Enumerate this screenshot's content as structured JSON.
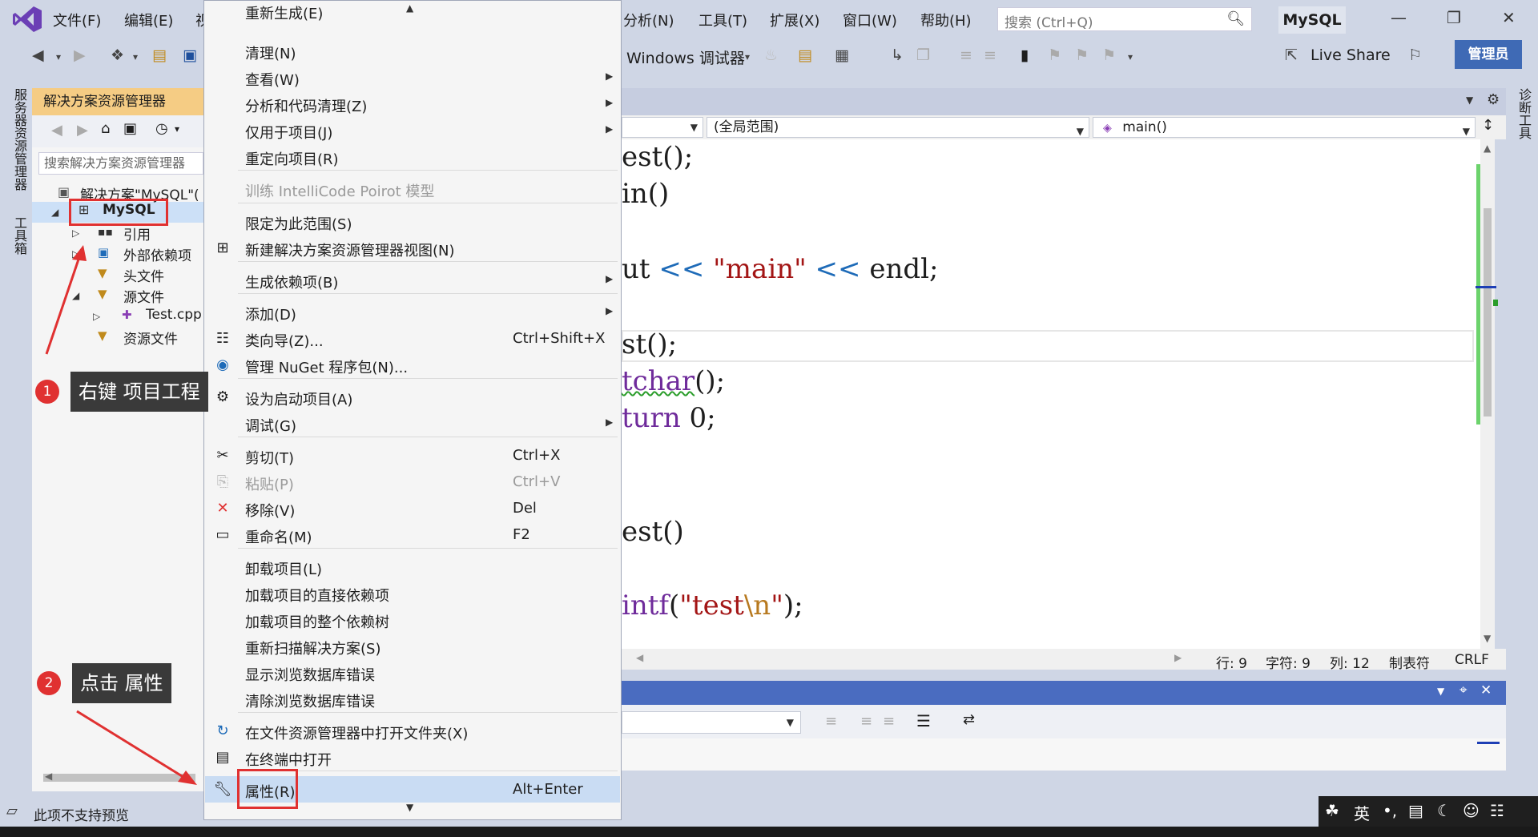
{
  "menubar": {
    "items": [
      "文件(F)",
      "编辑(E)",
      "视",
      "分析(N)",
      "工具(T)",
      "扩展(X)",
      "窗口(W)",
      "帮助(H)"
    ],
    "search_placeholder": "搜索 (Ctrl+Q)",
    "solution_name": "MySQL"
  },
  "toolbar": {
    "debugger_label": "Windows 调试器",
    "live_share": "Live Share",
    "admin": "管理员"
  },
  "left_rail": {
    "server_explorer": "服务器资源管理器",
    "toolbox": "工具箱"
  },
  "right_rail": {
    "diagnostics": "诊断工具"
  },
  "solution_explorer": {
    "title": "解决方案资源管理器",
    "search_placeholder": "搜索解决方案资源管理器",
    "tree": [
      {
        "label": "解决方案\"MySQL\"("
      },
      {
        "label": "MySQL"
      },
      {
        "label": "引用"
      },
      {
        "label": "外部依赖项"
      },
      {
        "label": "头文件"
      },
      {
        "label": "源文件"
      },
      {
        "label": "Test.cpp"
      },
      {
        "label": "资源文件"
      }
    ]
  },
  "editor": {
    "nav_scope": "(全局范围)",
    "nav_member": "main()",
    "code_lines": [
      "est();",
      "in()",
      "ut << \"main\" << endl;",
      "st();",
      "tchar();",
      "turn 0;",
      "est()",
      "intf(\"test\\n\");"
    ],
    "status": {
      "line": "行: 9",
      "char": "字符: 9",
      "col": "列: 12",
      "tab": "制表符",
      "eol": "CRLF"
    }
  },
  "context_menu": {
    "items": [
      {
        "label": "重新生成(E)",
        "shortcut": "",
        "submenu": false,
        "disabled": false
      },
      {
        "label": "清理(N)",
        "shortcut": "",
        "submenu": false,
        "disabled": false
      },
      {
        "label": "查看(W)",
        "shortcut": "",
        "submenu": true,
        "disabled": false
      },
      {
        "label": "分析和代码清理(Z)",
        "shortcut": "",
        "submenu": true,
        "disabled": false
      },
      {
        "label": "仅用于项目(J)",
        "shortcut": "",
        "submenu": true,
        "disabled": false
      },
      {
        "label": "重定向项目(R)",
        "shortcut": "",
        "submenu": false,
        "disabled": false
      },
      {
        "label": "训练 IntelliCode Poirot 模型",
        "shortcut": "",
        "submenu": false,
        "disabled": true
      },
      {
        "label": "限定为此范围(S)",
        "shortcut": "",
        "submenu": false,
        "disabled": false
      },
      {
        "label": "新建解决方案资源管理器视图(N)",
        "shortcut": "",
        "submenu": false,
        "disabled": false
      },
      {
        "label": "生成依赖项(B)",
        "shortcut": "",
        "submenu": true,
        "disabled": false
      },
      {
        "label": "添加(D)",
        "shortcut": "",
        "submenu": true,
        "disabled": false
      },
      {
        "label": "类向导(Z)...",
        "shortcut": "Ctrl+Shift+X",
        "submenu": false,
        "disabled": false
      },
      {
        "label": "管理 NuGet 程序包(N)...",
        "shortcut": "",
        "submenu": false,
        "disabled": false
      },
      {
        "label": "设为启动项目(A)",
        "shortcut": "",
        "submenu": false,
        "disabled": false
      },
      {
        "label": "调试(G)",
        "shortcut": "",
        "submenu": true,
        "disabled": false
      },
      {
        "label": "剪切(T)",
        "shortcut": "Ctrl+X",
        "submenu": false,
        "disabled": false
      },
      {
        "label": "粘贴(P)",
        "shortcut": "Ctrl+V",
        "submenu": false,
        "disabled": true
      },
      {
        "label": "移除(V)",
        "shortcut": "Del",
        "submenu": false,
        "disabled": false
      },
      {
        "label": "重命名(M)",
        "shortcut": "F2",
        "submenu": false,
        "disabled": false
      },
      {
        "label": "卸载项目(L)",
        "shortcut": "",
        "submenu": false,
        "disabled": false
      },
      {
        "label": "加载项目的直接依赖项",
        "shortcut": "",
        "submenu": false,
        "disabled": false
      },
      {
        "label": "加载项目的整个依赖树",
        "shortcut": "",
        "submenu": false,
        "disabled": false
      },
      {
        "label": "重新扫描解决方案(S)",
        "shortcut": "",
        "submenu": false,
        "disabled": false
      },
      {
        "label": "显示浏览数据库错误",
        "shortcut": "",
        "submenu": false,
        "disabled": false
      },
      {
        "label": "清除浏览数据库错误",
        "shortcut": "",
        "submenu": false,
        "disabled": false
      },
      {
        "label": "在文件资源管理器中打开文件夹(X)",
        "shortcut": "",
        "submenu": false,
        "disabled": false
      },
      {
        "label": "在终端中打开",
        "shortcut": "",
        "submenu": false,
        "disabled": false
      },
      {
        "label": "属性(R)",
        "shortcut": "Alt+Enter",
        "submenu": false,
        "disabled": false
      }
    ]
  },
  "annotations": {
    "step1_num": "1",
    "step1_text": "右键 项目工程",
    "step2_num": "2",
    "step2_text": "点击 属性"
  },
  "statusbar": {
    "text": "此项不支持预览"
  },
  "ime": {
    "lang": "英"
  },
  "colors": {
    "accent": "#3f6ab5",
    "highlight": "#c9dcf3",
    "annotation_red": "#e03131",
    "keyword": "#6f2b9b",
    "string": "#a31515"
  }
}
